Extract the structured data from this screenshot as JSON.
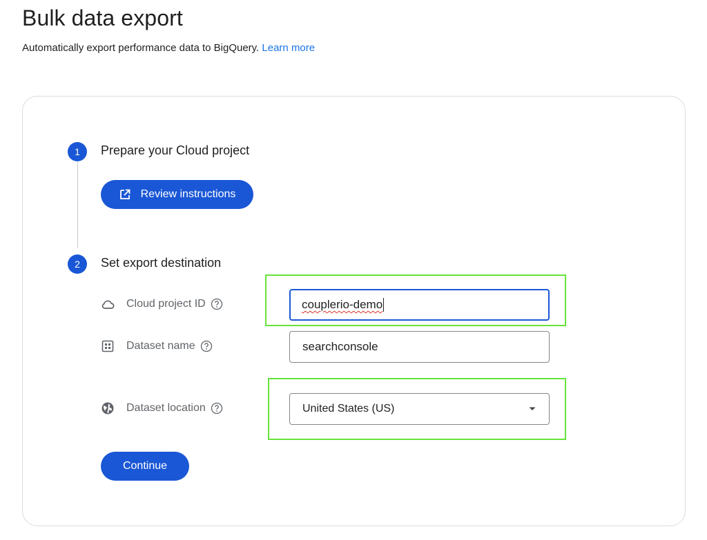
{
  "header": {
    "title": "Bulk data export",
    "subtitle": "Automatically export performance data to BigQuery.",
    "learn_more": "Learn more"
  },
  "steps": [
    {
      "number": "1",
      "title": "Prepare your Cloud project",
      "button_label": "Review instructions",
      "button_icon": "open-in-new-icon"
    },
    {
      "number": "2",
      "title": "Set export destination"
    }
  ],
  "form": {
    "project_id": {
      "label": "Cloud project ID",
      "icon": "cloud-icon",
      "value": "couplerio-demo"
    },
    "dataset_name": {
      "label": "Dataset name",
      "icon": "dataset-grid-icon",
      "value": "searchconsole"
    },
    "dataset_location": {
      "label": "Dataset location",
      "icon": "globe-icon",
      "selected": "United States (US)"
    },
    "continue_label": "Continue"
  },
  "colors": {
    "primary": "#1a57d6",
    "link": "#1a73e8",
    "highlight": "#66e33a"
  }
}
